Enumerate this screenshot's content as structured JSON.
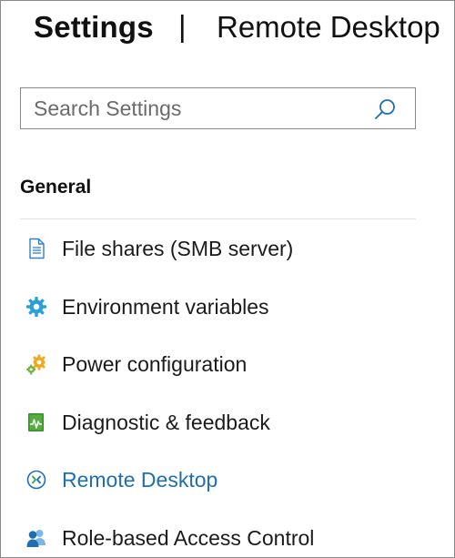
{
  "header": {
    "title": "Settings",
    "separator": "|",
    "subtitle": "Remote Desktop"
  },
  "search": {
    "placeholder": "Search Settings",
    "value": "",
    "icon": "search-icon"
  },
  "sections": [
    {
      "heading": "General",
      "items": [
        {
          "label": "File shares (SMB server)",
          "icon": "file-shares-icon",
          "active": false
        },
        {
          "label": "Environment variables",
          "icon": "environment-variables-icon",
          "active": false
        },
        {
          "label": "Power configuration",
          "icon": "power-configuration-icon",
          "active": false
        },
        {
          "label": "Diagnostic & feedback",
          "icon": "diagnostic-feedback-icon",
          "active": false
        },
        {
          "label": "Remote Desktop",
          "icon": "remote-desktop-icon",
          "active": true
        },
        {
          "label": "Role-based Access Control",
          "icon": "role-based-access-control-icon",
          "active": false
        }
      ]
    }
  ],
  "colors": {
    "accent": "#1e6fb1",
    "text": "#1b1b1b",
    "border": "#8a8a8a",
    "divider": "#e1e1e1"
  }
}
